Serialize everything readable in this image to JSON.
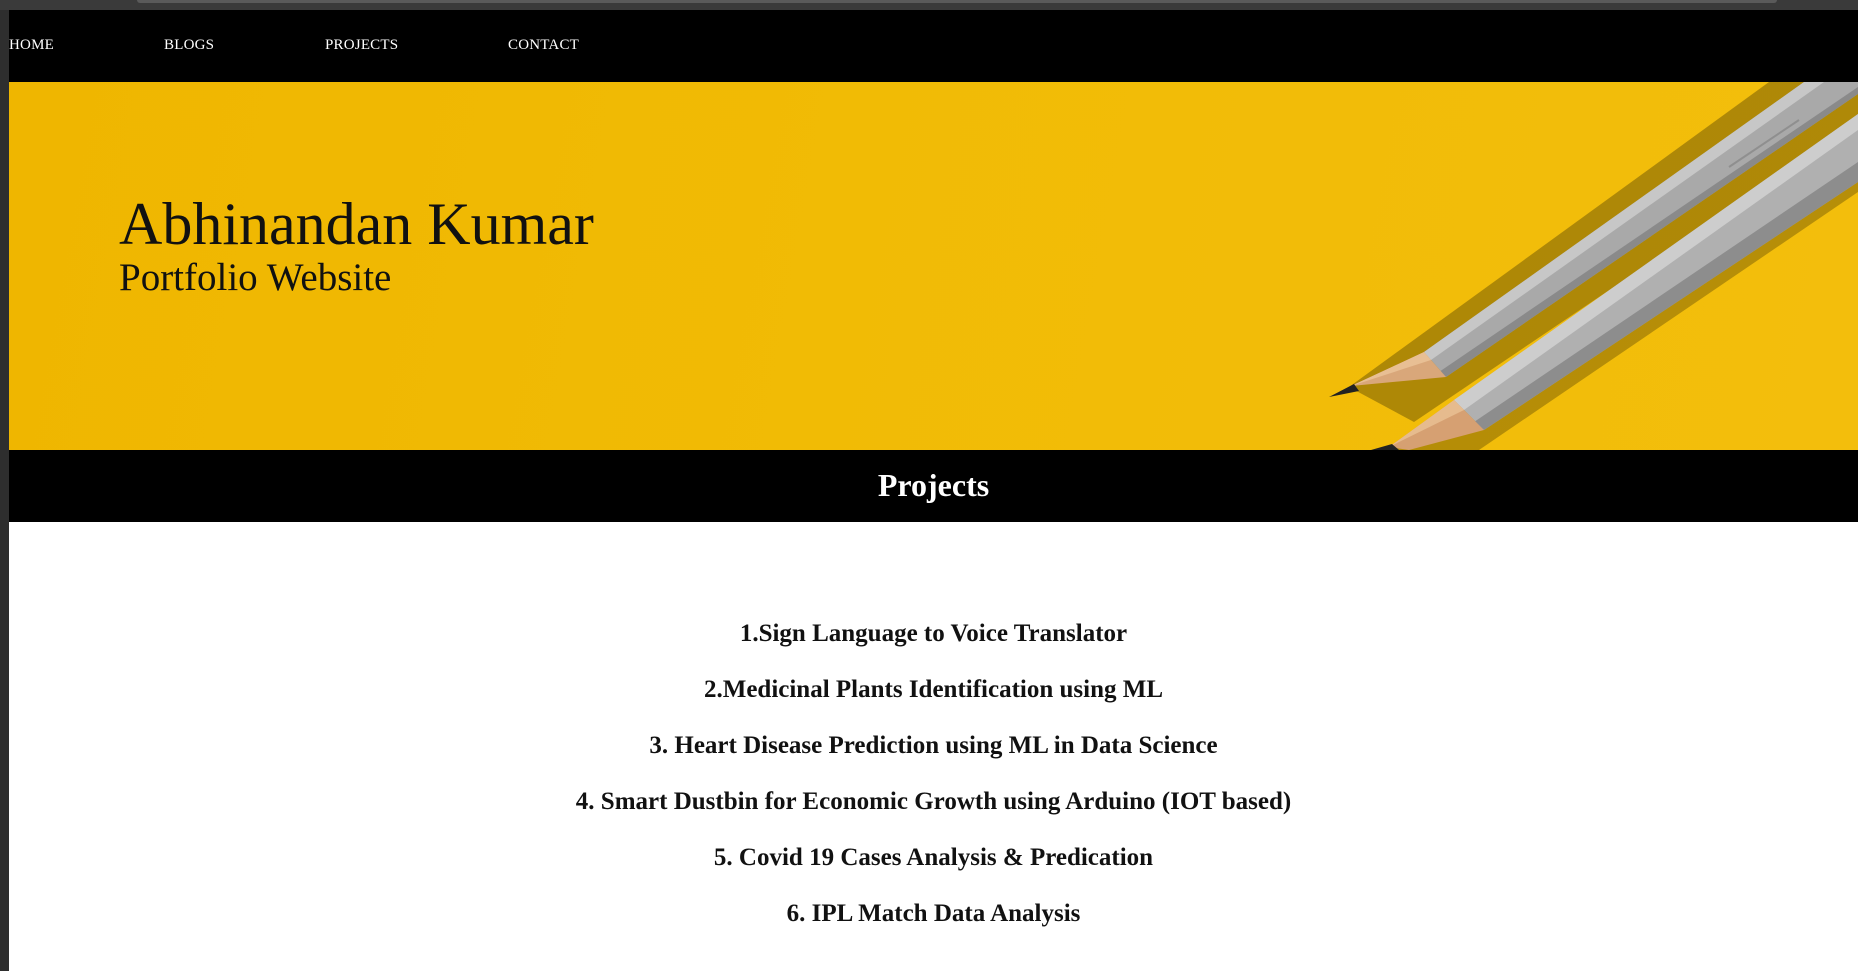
{
  "nav": {
    "links": [
      {
        "label": "HOME"
      },
      {
        "label": "BLOGS"
      },
      {
        "label": "PROJECTS"
      },
      {
        "label": "CONTACT"
      }
    ]
  },
  "hero": {
    "title": "Abhinandan Kumar",
    "subtitle": "Portfolio Website",
    "background_color": "#f1bb05",
    "image_name": "pencils-on-yellow-background"
  },
  "section": {
    "title": "Projects"
  },
  "projects": [
    "1.Sign Language to Voice Translator",
    "2.Medicinal Plants Identification using ML",
    "3. Heart Disease Prediction using ML in Data Science",
    "4. Smart Dustbin for Economic Growth using Arduino (IOT based)",
    "5. Covid 19 Cases Analysis & Predication",
    "6. IPL Match Data Analysis"
  ],
  "colors": {
    "nav_background": "#000000",
    "nav_text": "#ffffff",
    "accent_yellow": "#f1bb05",
    "body_text": "#111111"
  }
}
